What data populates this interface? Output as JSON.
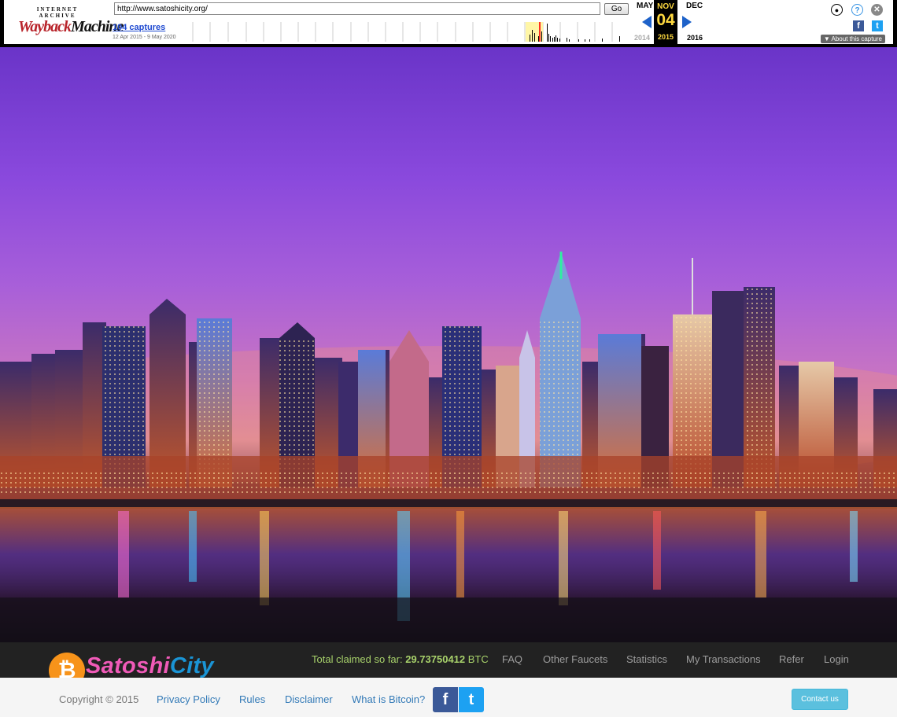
{
  "wayback": {
    "logo_top": "INTERNET ARCHIVE",
    "logo_wayback": "Wayback",
    "logo_machine": "Machine",
    "url": "http://www.satoshicity.org/",
    "go_label": "Go",
    "captures": "104 captures",
    "range": "12 Apr 2015 - 9 May 2020",
    "prev_month": "MAY",
    "cur_month": "NOV",
    "cur_day": "04",
    "next_month": "DEC",
    "prev_year": "2014",
    "cur_year": "2015",
    "next_year": "2016",
    "about": "About this capture",
    "icons": [
      "user-icon",
      "help-icon",
      "close-icon",
      "facebook-icon",
      "twitter-icon"
    ]
  },
  "hero": {
    "image": "night-city-skyline"
  },
  "nav": {
    "logo_coin": "₿",
    "logo_part1": "Satoshi",
    "logo_part2": "City",
    "claimed_label": "Total claimed so far: ",
    "claimed_value": "29.73750412",
    "claimed_unit": " BTC",
    "links": [
      "FAQ",
      "Other Faucets",
      "Statistics",
      "My Transactions",
      "Refer",
      "Login"
    ]
  },
  "footer": {
    "copyright": "Copyright © 2015",
    "links": [
      "Privacy Policy",
      "Rules",
      "Disclaimer",
      "What is Bitcoin?"
    ],
    "fb_glyph": "f",
    "tw_glyph": "t",
    "contact": "Contact us"
  },
  "colors": {
    "wayback_red": "#b8232a",
    "link_blue": "#337ab7",
    "claimed_green": "#a8d26b",
    "logo_pink": "#f05ab8",
    "logo_blue": "#1a94d5",
    "bitcoin_orange": "#f7931a",
    "contact_button": "#5bc0de"
  }
}
